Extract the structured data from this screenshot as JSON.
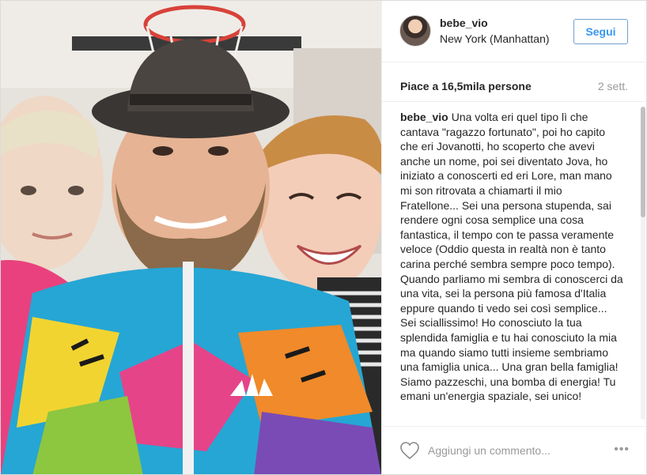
{
  "photo": {
    "subject": "selfie",
    "icon": "photo"
  },
  "header": {
    "username": "bebe_vio",
    "location": "New York (Manhattan)",
    "follow_label": "Segui"
  },
  "stats": {
    "likes": "Piace a 16,5mila persone",
    "time_ago": "2 sett."
  },
  "caption": {
    "username": "bebe_vio",
    "text": "Una volta eri quel tipo lì che cantava \"ragazzo fortunato\", poi ho capito che eri Jovanotti, ho scoperto che avevi anche un nome, poi sei diventato Jova, ho iniziato a conoscerti ed eri Lore, man mano mi son ritrovata a chiamarti il mio Fratellone... Sei una persona stupenda, sai rendere ogni cosa semplice una cosa fantastica, il tempo con te passa veramente veloce (Oddio questa in realtà non è tanto carina perché sembra sempre poco tempo). Quando parliamo mi sembra di conoscerci da una vita, sei la persona più famosa d'Italia eppure quando ti vedo sei così semplice... Sei sciallissimo! Ho conosciuto la tua splendida famiglia e tu hai conosciuto la mia ma quando siamo tutti insieme sembriamo una famiglia unica... Una gran bella famiglia! Siamo pazzeschi, una bomba di energia! Tu emani un'energia spaziale, sei unico!"
  },
  "footer": {
    "comment_placeholder": "Aggiungi un commento...",
    "more_label": "•••"
  },
  "colors": {
    "accent": "#3897f0",
    "border": "#dbdbdb",
    "muted": "#999999"
  }
}
